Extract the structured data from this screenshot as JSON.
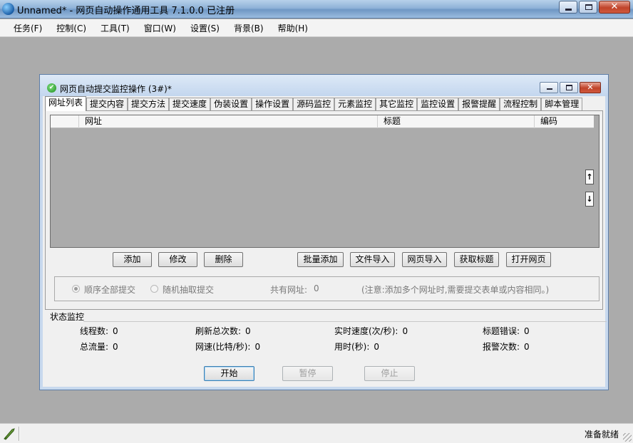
{
  "app": {
    "title": "Unnamed* - 网页自动操作通用工具 7.1.0.0  已注册"
  },
  "menu": [
    "任务(F)",
    "控制(C)",
    "工具(T)",
    "窗口(W)",
    "设置(S)",
    "背景(B)",
    "帮助(H)"
  ],
  "child_window": {
    "title": "网页自动提交监控操作 (3#)*"
  },
  "tabs": [
    "网址列表",
    "提交内容",
    "提交方法",
    "提交速度",
    "伪装设置",
    "操作设置",
    "源码监控",
    "元素监控",
    "其它监控",
    "监控设置",
    "报警提醒",
    "流程控制",
    "脚本管理"
  ],
  "active_tab": 0,
  "grid": {
    "columns": [
      "",
      "网址",
      "标题",
      "编码"
    ],
    "rows": [],
    "scroll_up": "↑",
    "scroll_down": "↓"
  },
  "buttons": {
    "add": "添加",
    "edit": "修改",
    "delete": "删除",
    "batch_add": "批量添加",
    "file_import": "文件导入",
    "web_import": "网页导入",
    "get_title": "获取标题",
    "open_page": "打开网页"
  },
  "options": {
    "sequential": "顺序全部提交",
    "random": "随机抽取提交",
    "total_urls_label": "共有网址:",
    "total_urls_value": "0",
    "note": "(注意:添加多个网址时,需要提交表单或内容相同。)"
  },
  "status": {
    "section_title": "状态监控",
    "threads_label": "线程数:",
    "threads_value": "0",
    "refresh_label": "刷新总次数:",
    "refresh_value": "0",
    "speed_label": "实时速度(次/秒):",
    "speed_value": "0",
    "title_err_label": "标题错误:",
    "title_err_value": "0",
    "traffic_label": "总流量:",
    "traffic_value": "0",
    "netspeed_label": "网速(比特/秒):",
    "netspeed_value": "0",
    "elapsed_label": "用时(秒):",
    "elapsed_value": "0",
    "alarm_label": "报警次数:",
    "alarm_value": "0"
  },
  "controls": {
    "start": "开始",
    "pause": "暂停",
    "stop": "停止"
  },
  "statusbar": {
    "text": "准备就绪"
  }
}
